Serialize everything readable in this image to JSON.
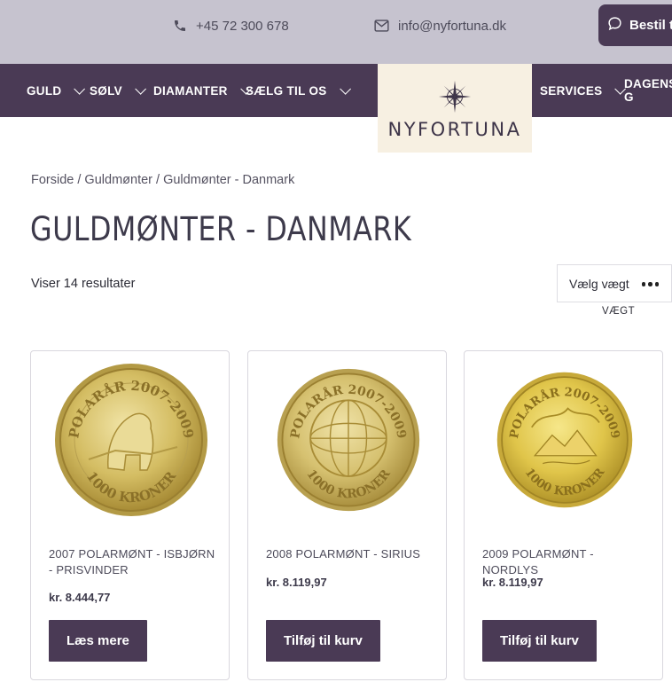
{
  "topbar": {
    "phone": "+45 72 300 678",
    "email": "info@nyfortuna.dk",
    "order_button": "Bestil t"
  },
  "nav": {
    "items": [
      {
        "label": "GULD"
      },
      {
        "label": "SØLV"
      },
      {
        "label": "DIAMANTER"
      },
      {
        "label": "SÆLG TIL OS"
      },
      {
        "label": "SERVICES"
      },
      {
        "label": "DAGENS G"
      }
    ],
    "logo_text": "NYFORTUNA"
  },
  "breadcrumb": "Forside / Guldmønter / Guldmønter - Danmark",
  "page_title": "GULDMØNTER - DANMARK",
  "results_text": "Viser 14 resultater",
  "weight_filter": {
    "selected": "Vælg vægt",
    "label": "VÆGT"
  },
  "products": [
    {
      "title": "2007 POLARMØNT - ISBJØRN - PRISVINDER",
      "price": "kr. 8.444,77",
      "button": "Læs mere",
      "coin": {
        "top_text": "POLARÅR 2007-2009",
        "bottom_text": "1000 KRONER",
        "motif": "polar-bear"
      }
    },
    {
      "title": "2008 POLARMØNT - SIRIUS",
      "price": "kr. 8.119,97",
      "button": "Tilføj til kurv",
      "coin": {
        "top_text": "POLARÅR 2007-2009",
        "bottom_text": "1000 KRONER",
        "motif": "globe"
      }
    },
    {
      "title": "2009 POLARMØNT - NORDLYS",
      "price": "kr. 8.119,97",
      "button": "Tilføj til kurv",
      "coin": {
        "top_text": "POLARÅR 2007-2009",
        "bottom_text": "1000 KRONER",
        "motif": "northern-lights"
      }
    }
  ],
  "colors": {
    "brand_purple": "#4a3a55",
    "topbar_bg": "#c6c3cf",
    "logo_bg": "#f7f0e2",
    "gold": "#d8c068"
  }
}
